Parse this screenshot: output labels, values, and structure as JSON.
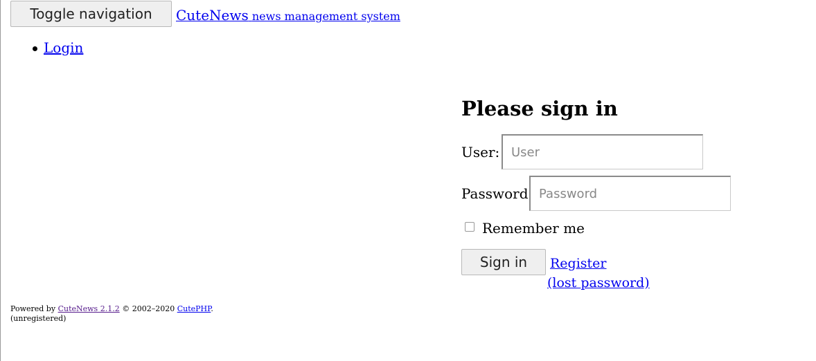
{
  "navbar": {
    "toggle_label": "Toggle navigation",
    "brand_main": "CuteNews",
    "brand_sub": "news management system"
  },
  "nav": {
    "items": [
      {
        "label": "Login"
      }
    ]
  },
  "login": {
    "heading": "Please sign in",
    "user_label": "User:",
    "user_placeholder": "User",
    "password_label": "Password",
    "password_placeholder": "Password",
    "remember_label": "Remember me",
    "remember_checked": false,
    "signin_label": "Sign in",
    "register_link": "Register",
    "lost_password_link": "(lost password)"
  },
  "footer": {
    "powered_by": "Powered by",
    "version_link": "CuteNews 2.1.2",
    "copyright": "© 2002–2020",
    "company_link": "CutePHP",
    "period": ".",
    "status": "(unregistered)"
  },
  "colors": {
    "link": "#0000ee",
    "visited_link": "#551a8b",
    "button_bg": "#efefef"
  }
}
